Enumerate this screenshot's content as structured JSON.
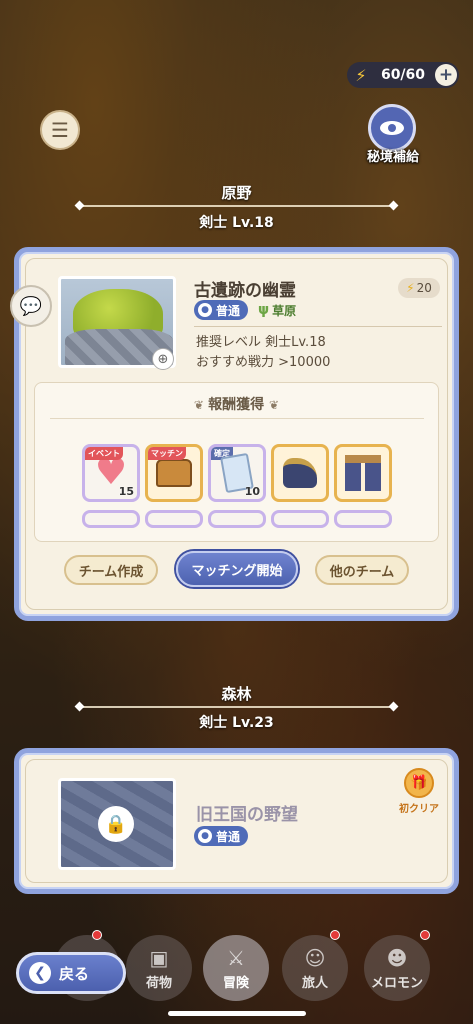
{
  "header": {
    "energy": "60/60",
    "energy_plus": "+",
    "secret_supply_label": "秘境補給"
  },
  "areas": [
    {
      "title": "原野",
      "level": "剣士 Lv.18",
      "stage": {
        "name": "古遺跡の幽霊",
        "stamina_cost": "20",
        "difficulty": "普通",
        "terrain": "草原",
        "recommended_level": "推奨レベル 剣士Lv.18",
        "recommended_power": "おすすめ戦力 >10000",
        "rewards_title": "報酬獲得",
        "rewards": [
          {
            "tag": "イベント",
            "count": "15",
            "icon": "heart-icon"
          },
          {
            "tag": "マッチン",
            "count": "",
            "icon": "chest-icon"
          },
          {
            "tag": "確定",
            "count": "10",
            "icon": "ticket-icon"
          },
          {
            "tag": "",
            "count": "",
            "icon": "boots-icon"
          },
          {
            "tag": "",
            "count": "",
            "icon": "armor-icon"
          }
        ],
        "buttons": {
          "create_team": "チーム作成",
          "start_matching": "マッチング開始",
          "other_team": "他のチーム"
        }
      }
    },
    {
      "title": "森林",
      "level": "剣士 Lv.23",
      "stage": {
        "name": "旧王国の野望",
        "difficulty": "普通",
        "first_clear": "初クリア"
      }
    }
  ],
  "nav": {
    "back": "戻る",
    "items": [
      "荷物",
      "冒険",
      "旅人",
      "メロモン"
    ]
  },
  "colors": {
    "accent_blue": "#4f6bb8",
    "card_border": "#8fa3de",
    "card_bg": "#f7f1e3"
  }
}
